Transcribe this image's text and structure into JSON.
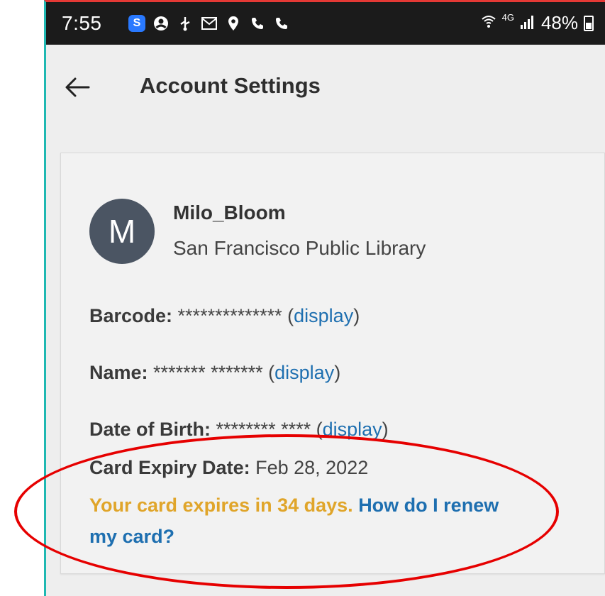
{
  "statusbar": {
    "time": "7:55",
    "app_icon_letter": "S",
    "icons": [
      "app-s-icon",
      "account-icon",
      "usb-icon",
      "gmail-icon",
      "location-icon",
      "phone-icon",
      "phone-icon"
    ],
    "network": "4G",
    "battery": "48%"
  },
  "appbar": {
    "title": "Account Settings",
    "back_icon": "arrow-left-icon"
  },
  "profile": {
    "avatar_letter": "M",
    "avatar_color": "#4b5563",
    "username": "Milo_Bloom",
    "library": "San Francisco Public Library"
  },
  "fields": {
    "barcode": {
      "label": "Barcode:",
      "value": "************** (",
      "link": "display",
      "close": ")"
    },
    "name": {
      "label": "Name:",
      "value": "******* ******* (",
      "link": "display",
      "close": ")"
    },
    "dob": {
      "label": "Date of Birth:",
      "value": "******** **** (",
      "link": "display",
      "close": ")"
    },
    "expiry": {
      "label": "Card Expiry Date:",
      "value": "Feb 28, 2022"
    }
  },
  "expiry_message": {
    "warning": "Your card expires in 34 days.",
    "renew_link": "How do I renew my card?"
  },
  "colors": {
    "link": "#1e6fb0",
    "warning": "#e0a52a",
    "annotation": "#e60000",
    "frame_left": "#1fb8b2"
  }
}
